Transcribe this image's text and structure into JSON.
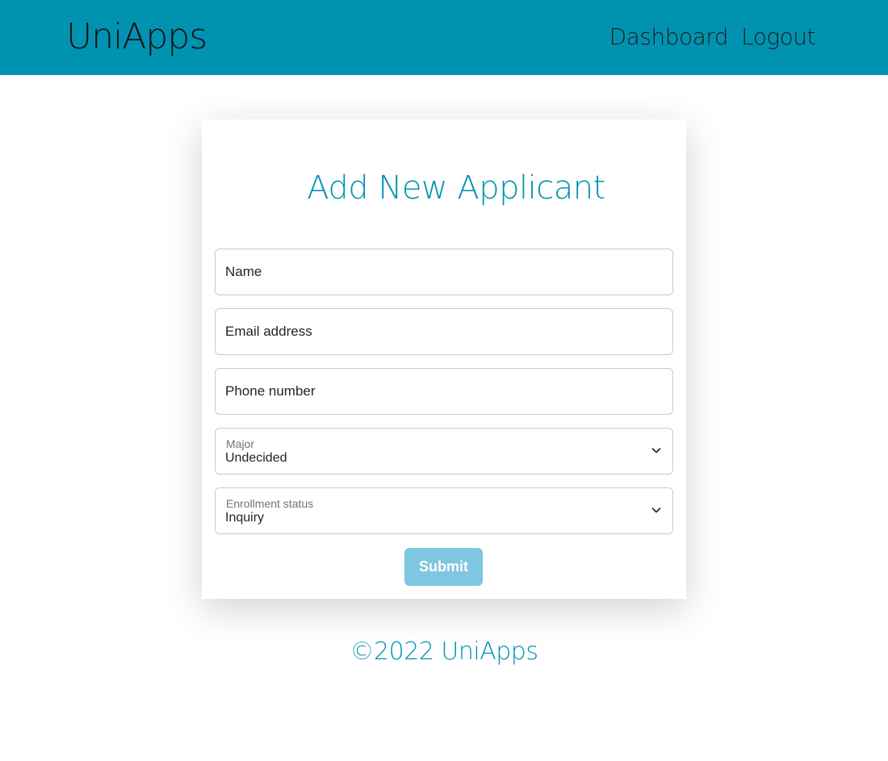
{
  "header": {
    "brand": "UniApps",
    "nav": [
      "Dashboard",
      "Logout"
    ]
  },
  "form": {
    "title": "Add New Applicant",
    "name_placeholder": "Name",
    "email_placeholder": "Email address",
    "phone_placeholder": "Phone number",
    "major": {
      "label": "Major",
      "value": "Undecided"
    },
    "enrollment": {
      "label": "Enrollment status",
      "value": "Inquiry"
    },
    "submit_label": "Submit"
  },
  "footer": {
    "text": "©2022 UniApps"
  },
  "colors": {
    "accent": "#0093b1",
    "submit": "#7fc6e0"
  }
}
